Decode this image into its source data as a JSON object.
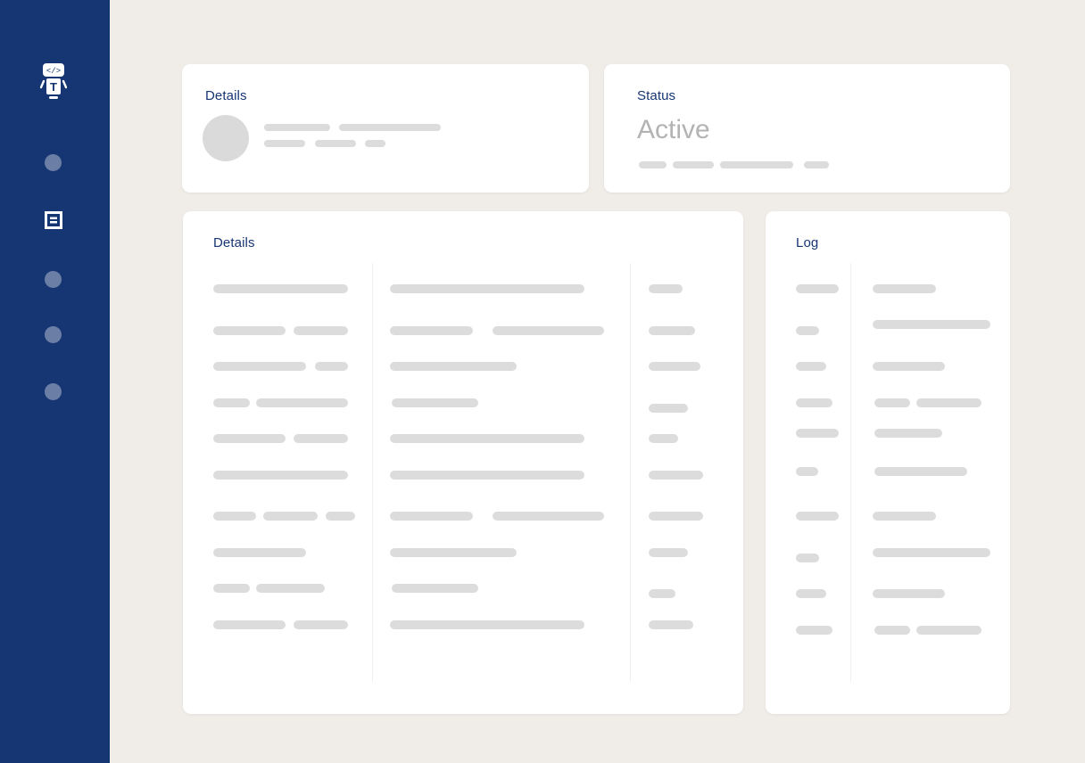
{
  "sidebar": {
    "logo_icon": "robot-code-icon",
    "items": [
      {
        "icon": "nav-dot-icon",
        "active": false
      },
      {
        "icon": "document-icon",
        "active": true
      },
      {
        "icon": "nav-dot-icon",
        "active": false
      },
      {
        "icon": "nav-dot-icon",
        "active": false
      },
      {
        "icon": "nav-dot-icon",
        "active": false
      }
    ],
    "color": "#163573"
  },
  "cards": {
    "details_top": {
      "title": "Details"
    },
    "status": {
      "title": "Status",
      "value": "Active"
    },
    "details_main": {
      "title": "Details"
    },
    "log": {
      "title": "Log"
    }
  },
  "colors": {
    "background": "#f0ece8",
    "card": "#ffffff",
    "placeholder": "#dcdcdc",
    "title": "#163573"
  }
}
